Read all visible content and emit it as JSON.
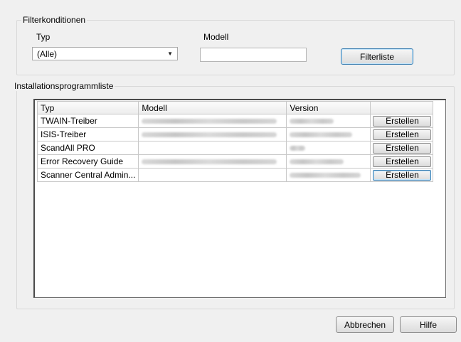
{
  "filter": {
    "title": "Filterkonditionen",
    "type_label": "Typ",
    "type_value": "(Alle)",
    "model_label": "Modell",
    "model_value": "",
    "filter_button": "Filterliste"
  },
  "installer": {
    "title": "Installationsprogrammliste",
    "columns": [
      "Typ",
      "Modell",
      "Version",
      ""
    ],
    "rows": [
      {
        "type": "TWAIN-Treiber",
        "button": "Erstellen"
      },
      {
        "type": "ISIS-Treiber",
        "button": "Erstellen"
      },
      {
        "type": "ScandAll PRO",
        "button": "Erstellen"
      },
      {
        "type": "Error Recovery Guide",
        "button": "Erstellen"
      },
      {
        "type": "Scanner Central Admin...",
        "button": "Erstellen"
      }
    ]
  },
  "footer": {
    "cancel": "Abbrechen",
    "help": "Hilfe"
  },
  "icons": {
    "combo_arrow": "triangle-down-icon"
  }
}
